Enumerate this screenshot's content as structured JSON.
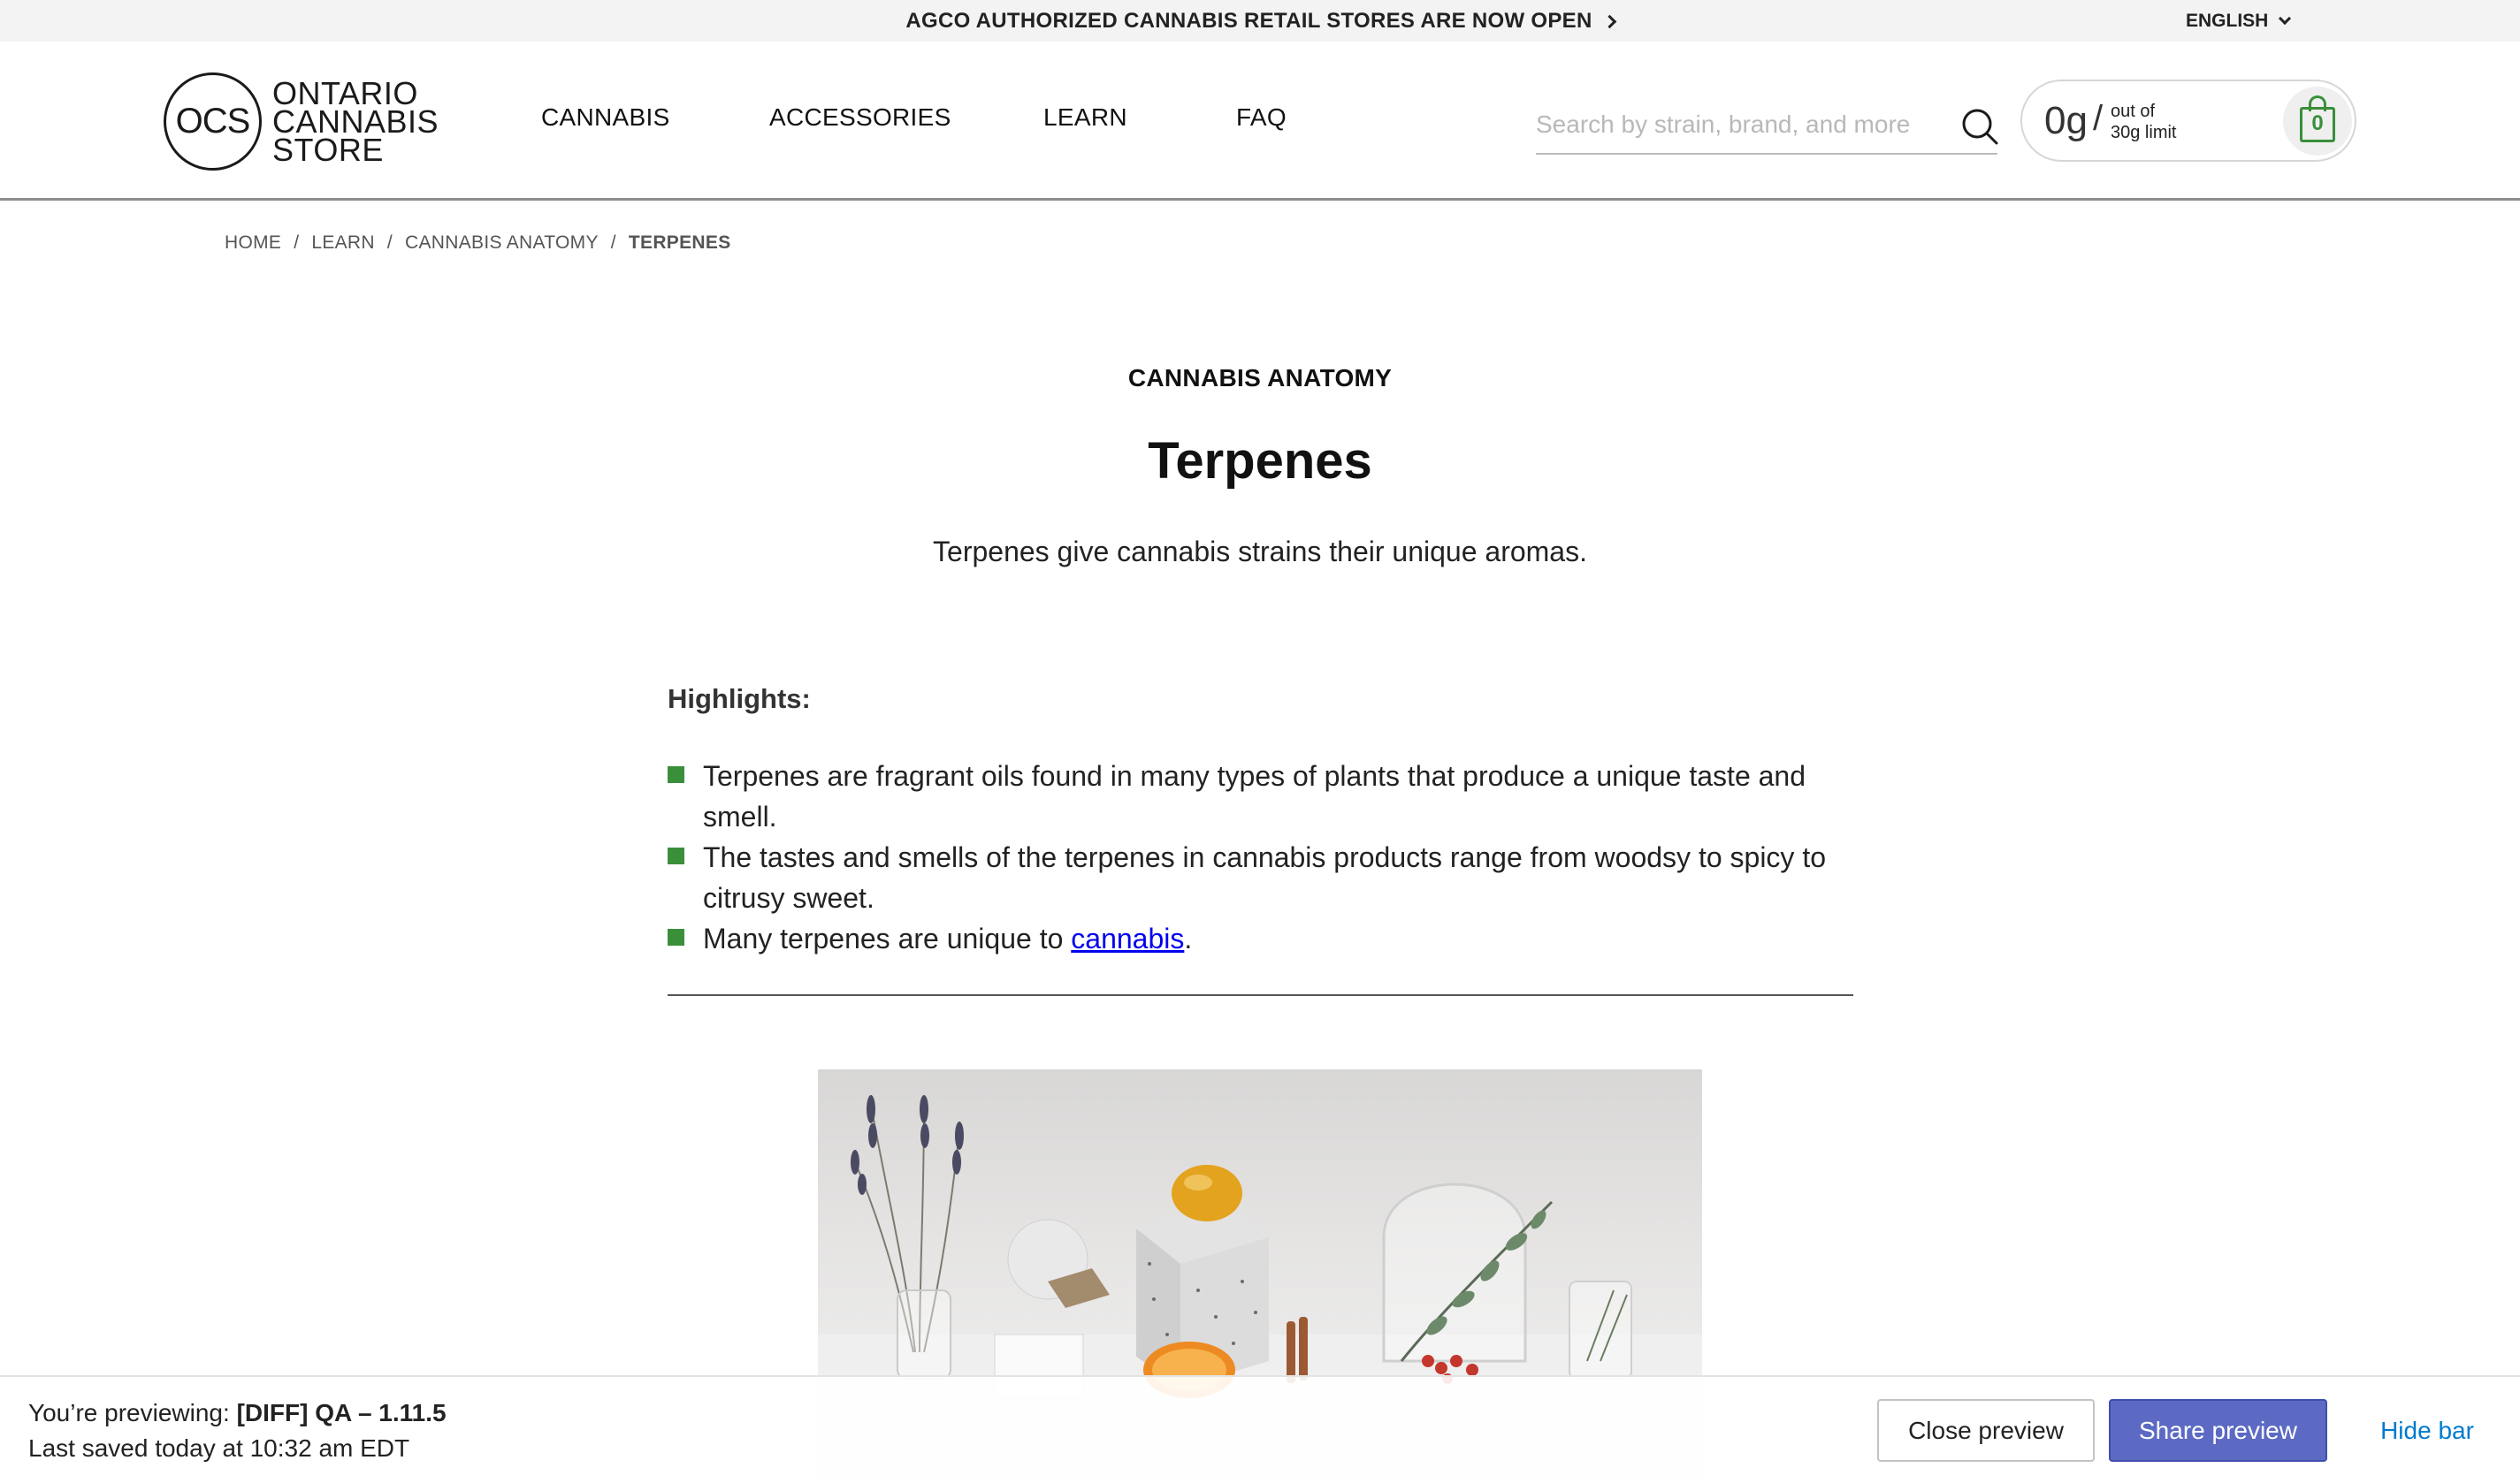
{
  "announcement": {
    "text": "AGCO AUTHORIZED CANNABIS RETAIL STORES ARE NOW OPEN"
  },
  "language": {
    "selected": "ENGLISH"
  },
  "logo": {
    "abbr": "OCS",
    "line1": "ONTARIO",
    "line2": "CANNABIS",
    "line3": "STORE"
  },
  "nav": {
    "items": [
      {
        "label": "CANNABIS"
      },
      {
        "label": "ACCESSORIES"
      },
      {
        "label": "LEARN"
      },
      {
        "label": "FAQ"
      }
    ]
  },
  "search": {
    "placeholder": "Search by strain, brand, and more",
    "value": ""
  },
  "limit": {
    "grams": "0g",
    "slash": "/",
    "outof_line1": "out of",
    "outof_line2": "30g limit",
    "cart_count": "0"
  },
  "breadcrumb": {
    "items": [
      "HOME",
      "LEARN",
      "CANNABIS ANATOMY"
    ],
    "separator": "/",
    "current": "TERPENES"
  },
  "article": {
    "eyebrow": "CANNABIS ANATOMY",
    "title": "Terpenes",
    "subtitle": "Terpenes give cannabis strains their unique aromas.",
    "highlights_label": "Highlights:",
    "highlights": [
      "Terpenes are fragrant oils found in many types of plants that produce a unique taste and smell.",
      "The tastes and smells of the terpenes in cannabis products range from woodsy to spicy to citrusy sweet.",
      "Many terpenes are unique to"
    ],
    "highlight_link": "cannabis",
    "highlight_link_suffix": "."
  },
  "preview": {
    "line1_prefix": "You’re previewing:",
    "theme_name": "[DIFF] QA – 1.11.5",
    "line2": "Last saved today at 10:32 am EDT",
    "close_label": "Close preview",
    "share_label": "Share preview",
    "hide_label": "Hide bar"
  },
  "colors": {
    "accent_green": "#3a8f3a",
    "share_button": "#5c6ac4",
    "hide_link": "#007ace"
  }
}
